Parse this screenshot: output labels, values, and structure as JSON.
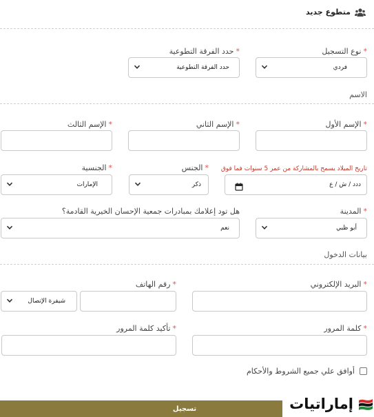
{
  "header": {
    "title": "متطوع جديد",
    "icon": "users-icon"
  },
  "registration_type": {
    "label": "نوع التسجيل",
    "value": "فردي"
  },
  "team_size": {
    "label": "حدد الفرقة التطوعية",
    "value": "حدد الفرقة التطوعية"
  },
  "name_section": {
    "title": "الاسم"
  },
  "first_name": {
    "label": "الإسم الأول",
    "value": ""
  },
  "second_name": {
    "label": "الإسم الثاني",
    "value": ""
  },
  "third_name": {
    "label": "الإسم الثالث",
    "value": ""
  },
  "birth_date": {
    "label": "تاريخ الميلاد يسمح بالمشاركة من عمر 5 سنوات فما فوق",
    "placeholder": "dd / mm / yyyy",
    "value": "ددد / ش / ع"
  },
  "gender": {
    "label": "الجنس",
    "value": "ذكر"
  },
  "nationality": {
    "label": "الجنسية",
    "value": "الإمارات"
  },
  "city": {
    "label": "المدينة",
    "value": "أبو ظبي"
  },
  "notifications": {
    "label": "هل تود إعلامك بمبادرات جمعية الإحسان الخيرية القادمة؟",
    "value": "نعم"
  },
  "login_section": {
    "title": "بيانات الدخول"
  },
  "email": {
    "label": "البريد الإلكتروني",
    "value": ""
  },
  "phone": {
    "label": "رقم الهاتف",
    "value": "",
    "prefix_value": "شيفرة الإتصال"
  },
  "password": {
    "label": "كلمة المرور",
    "value": ""
  },
  "confirm_password": {
    "label": "تأكيد كلمة المرور",
    "value": ""
  },
  "terms": {
    "label": "أوافق علي جميع الشروط والأحكام",
    "checked": false
  },
  "submit": {
    "label": "تسجيل"
  },
  "logo": {
    "text": "إماراتيات"
  },
  "colors": {
    "required": "#d9534f",
    "button": "#8a7a3e",
    "note": "#c0392b"
  }
}
